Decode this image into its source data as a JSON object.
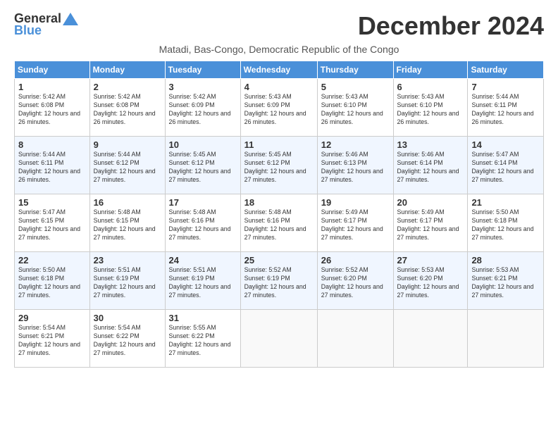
{
  "logo": {
    "general": "General",
    "blue": "Blue"
  },
  "title": "December 2024",
  "subtitle": "Matadi, Bas-Congo, Democratic Republic of the Congo",
  "days_header": [
    "Sunday",
    "Monday",
    "Tuesday",
    "Wednesday",
    "Thursday",
    "Friday",
    "Saturday"
  ],
  "weeks": [
    [
      {
        "day": "1",
        "sunrise": "5:42 AM",
        "sunset": "6:08 PM",
        "daylight": "12 hours and 26 minutes."
      },
      {
        "day": "2",
        "sunrise": "5:42 AM",
        "sunset": "6:08 PM",
        "daylight": "12 hours and 26 minutes."
      },
      {
        "day": "3",
        "sunrise": "5:42 AM",
        "sunset": "6:09 PM",
        "daylight": "12 hours and 26 minutes."
      },
      {
        "day": "4",
        "sunrise": "5:43 AM",
        "sunset": "6:09 PM",
        "daylight": "12 hours and 26 minutes."
      },
      {
        "day": "5",
        "sunrise": "5:43 AM",
        "sunset": "6:10 PM",
        "daylight": "12 hours and 26 minutes."
      },
      {
        "day": "6",
        "sunrise": "5:43 AM",
        "sunset": "6:10 PM",
        "daylight": "12 hours and 26 minutes."
      },
      {
        "day": "7",
        "sunrise": "5:44 AM",
        "sunset": "6:11 PM",
        "daylight": "12 hours and 26 minutes."
      }
    ],
    [
      {
        "day": "8",
        "sunrise": "5:44 AM",
        "sunset": "6:11 PM",
        "daylight": "12 hours and 26 minutes."
      },
      {
        "day": "9",
        "sunrise": "5:44 AM",
        "sunset": "6:12 PM",
        "daylight": "12 hours and 27 minutes."
      },
      {
        "day": "10",
        "sunrise": "5:45 AM",
        "sunset": "6:12 PM",
        "daylight": "12 hours and 27 minutes."
      },
      {
        "day": "11",
        "sunrise": "5:45 AM",
        "sunset": "6:12 PM",
        "daylight": "12 hours and 27 minutes."
      },
      {
        "day": "12",
        "sunrise": "5:46 AM",
        "sunset": "6:13 PM",
        "daylight": "12 hours and 27 minutes."
      },
      {
        "day": "13",
        "sunrise": "5:46 AM",
        "sunset": "6:14 PM",
        "daylight": "12 hours and 27 minutes."
      },
      {
        "day": "14",
        "sunrise": "5:47 AM",
        "sunset": "6:14 PM",
        "daylight": "12 hours and 27 minutes."
      }
    ],
    [
      {
        "day": "15",
        "sunrise": "5:47 AM",
        "sunset": "6:15 PM",
        "daylight": "12 hours and 27 minutes."
      },
      {
        "day": "16",
        "sunrise": "5:48 AM",
        "sunset": "6:15 PM",
        "daylight": "12 hours and 27 minutes."
      },
      {
        "day": "17",
        "sunrise": "5:48 AM",
        "sunset": "6:16 PM",
        "daylight": "12 hours and 27 minutes."
      },
      {
        "day": "18",
        "sunrise": "5:48 AM",
        "sunset": "6:16 PM",
        "daylight": "12 hours and 27 minutes."
      },
      {
        "day": "19",
        "sunrise": "5:49 AM",
        "sunset": "6:17 PM",
        "daylight": "12 hours and 27 minutes."
      },
      {
        "day": "20",
        "sunrise": "5:49 AM",
        "sunset": "6:17 PM",
        "daylight": "12 hours and 27 minutes."
      },
      {
        "day": "21",
        "sunrise": "5:50 AM",
        "sunset": "6:18 PM",
        "daylight": "12 hours and 27 minutes."
      }
    ],
    [
      {
        "day": "22",
        "sunrise": "5:50 AM",
        "sunset": "6:18 PM",
        "daylight": "12 hours and 27 minutes."
      },
      {
        "day": "23",
        "sunrise": "5:51 AM",
        "sunset": "6:19 PM",
        "daylight": "12 hours and 27 minutes."
      },
      {
        "day": "24",
        "sunrise": "5:51 AM",
        "sunset": "6:19 PM",
        "daylight": "12 hours and 27 minutes."
      },
      {
        "day": "25",
        "sunrise": "5:52 AM",
        "sunset": "6:19 PM",
        "daylight": "12 hours and 27 minutes."
      },
      {
        "day": "26",
        "sunrise": "5:52 AM",
        "sunset": "6:20 PM",
        "daylight": "12 hours and 27 minutes."
      },
      {
        "day": "27",
        "sunrise": "5:53 AM",
        "sunset": "6:20 PM",
        "daylight": "12 hours and 27 minutes."
      },
      {
        "day": "28",
        "sunrise": "5:53 AM",
        "sunset": "6:21 PM",
        "daylight": "12 hours and 27 minutes."
      }
    ],
    [
      {
        "day": "29",
        "sunrise": "5:54 AM",
        "sunset": "6:21 PM",
        "daylight": "12 hours and 27 minutes."
      },
      {
        "day": "30",
        "sunrise": "5:54 AM",
        "sunset": "6:22 PM",
        "daylight": "12 hours and 27 minutes."
      },
      {
        "day": "31",
        "sunrise": "5:55 AM",
        "sunset": "6:22 PM",
        "daylight": "12 hours and 27 minutes."
      },
      null,
      null,
      null,
      null
    ]
  ]
}
